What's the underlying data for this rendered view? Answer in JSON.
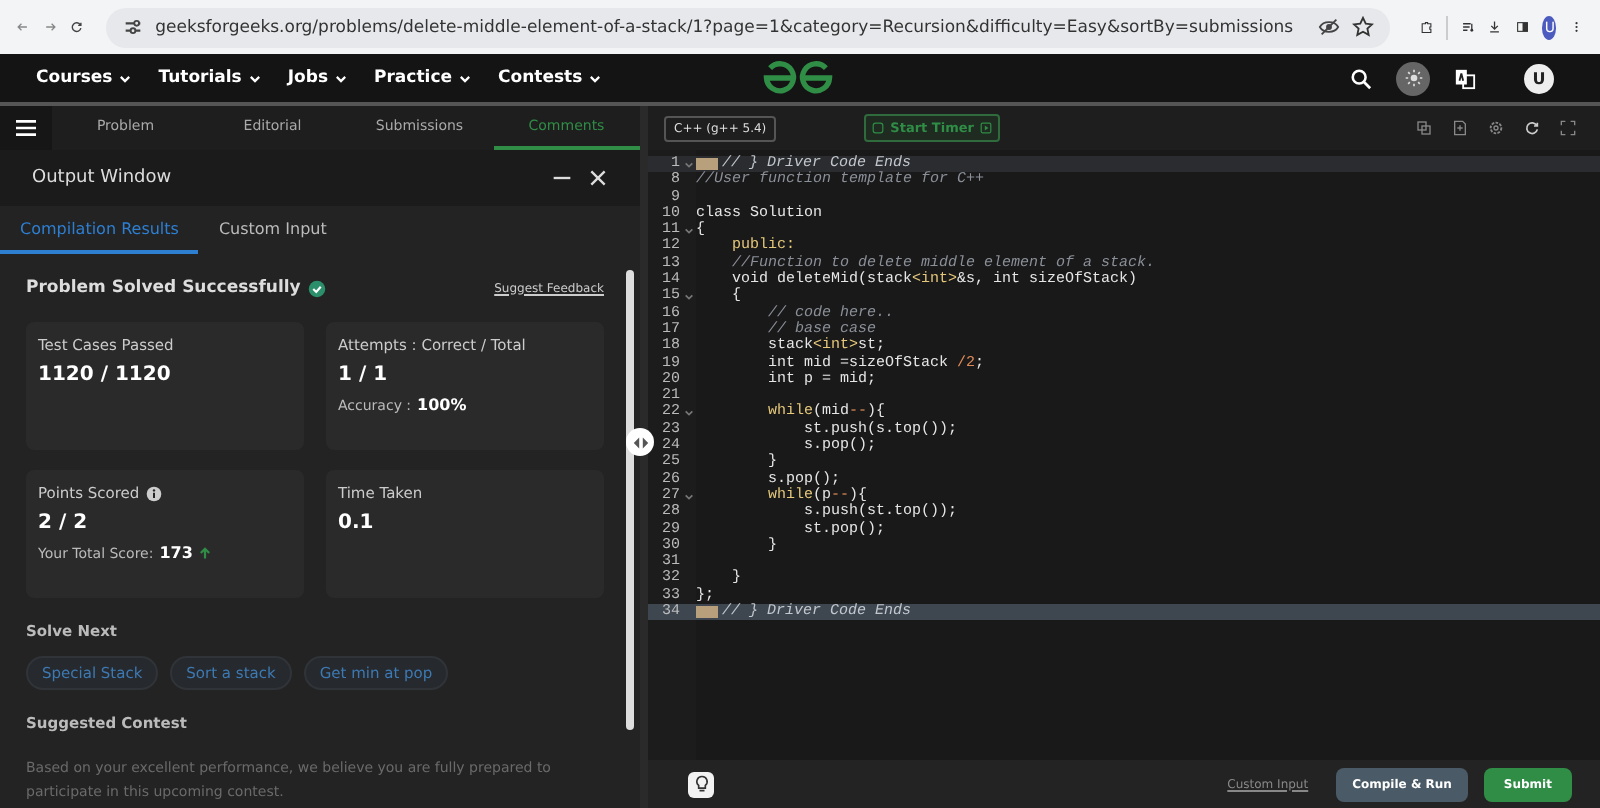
{
  "browser": {
    "url": "geeksforgeeks.org/problems/delete-middle-element-of-a-stack/1?page=1&category=Recursion&difficulty=Easy&sortBy=submissions",
    "avatar": "U"
  },
  "nav": {
    "items": [
      "Courses",
      "Tutorials",
      "Jobs",
      "Practice",
      "Contests"
    ],
    "avatar": "U"
  },
  "problem_tabs": [
    {
      "label": "Problem",
      "selected": false
    },
    {
      "label": "Editorial",
      "selected": false
    },
    {
      "label": "Submissions",
      "selected": false
    },
    {
      "label": "Comments",
      "selected": true
    }
  ],
  "output_window": {
    "title": "Output Window",
    "tabs": [
      {
        "label": "Compilation Results",
        "selected": true
      },
      {
        "label": "Custom Input",
        "selected": false
      }
    ],
    "status": "Problem Solved Successfully",
    "feedback_link": "Suggest Feedback",
    "cards": [
      {
        "label": "Test Cases Passed",
        "value": "1120 / 1120"
      },
      {
        "label": "Attempts : Correct / Total",
        "value": "1 / 1",
        "note": "Accuracy :",
        "note_value": "100%"
      },
      {
        "label": "Points Scored",
        "value": "2 / 2",
        "note": "Your Total Score:",
        "note_value": "173",
        "info": true,
        "trend_up": true
      },
      {
        "label": "Time Taken",
        "value": "0.1"
      }
    ],
    "solve_next": {
      "title": "Solve Next",
      "items": [
        "Special Stack",
        "Sort a stack",
        "Get min at pop"
      ]
    },
    "suggested_contest": {
      "title": "Suggested Contest",
      "text": "Based on your excellent performance, we believe you are fully prepared to participate in this upcoming contest."
    }
  },
  "editor": {
    "language": "C++ (g++ 5.4)",
    "timer": "Start Timer",
    "lines": [
      {
        "num": "1",
        "foldable": true,
        "collapsed": true,
        "highlighted": true,
        "segments": [
          {
            "t": "// } Driver Code Ends",
            "kind": "comment"
          }
        ]
      },
      {
        "num": "8",
        "segments": [
          {
            "t": "//User function template for C++",
            "kind": "comment"
          }
        ]
      },
      {
        "num": "9"
      },
      {
        "num": "10",
        "segments": [
          {
            "t": "class Solution",
            "kind": "code"
          }
        ]
      },
      {
        "num": "11",
        "foldable": true,
        "segments": [
          {
            "t": "{",
            "kind": "code"
          }
        ]
      },
      {
        "num": "12",
        "segments": [
          {
            "t": "    public:",
            "kind": "keyword"
          }
        ]
      },
      {
        "num": "13",
        "segments": [
          {
            "t": "    //Function to delete middle element of a stack.",
            "kind": "comment"
          }
        ]
      },
      {
        "num": "14",
        "segments": [
          {
            "t": "    void deleteMid(stack",
            "kind": "code"
          },
          {
            "t": "<int>",
            "kind": "keyword"
          },
          {
            "t": "&s, int sizeOfStack)",
            "kind": "code"
          }
        ]
      },
      {
        "num": "15",
        "foldable": true,
        "segments": [
          {
            "t": "    {",
            "kind": "code"
          }
        ]
      },
      {
        "num": "16",
        "segments": [
          {
            "t": "        // code here..",
            "kind": "comment"
          }
        ]
      },
      {
        "num": "17",
        "segments": [
          {
            "t": "        // base case",
            "kind": "comment"
          }
        ]
      },
      {
        "num": "18",
        "segments": [
          {
            "t": "        stack",
            "kind": "code"
          },
          {
            "t": "<int>",
            "kind": "keyword"
          },
          {
            "t": "st;",
            "kind": "code"
          }
        ]
      },
      {
        "num": "19",
        "segments": [
          {
            "t": "        int mid =sizeOfStack ",
            "kind": "code"
          },
          {
            "t": "/2",
            "kind": "operator"
          },
          {
            "t": ";",
            "kind": "code"
          }
        ]
      },
      {
        "num": "20",
        "segments": [
          {
            "t": "        int p = mid;",
            "kind": "code"
          }
        ]
      },
      {
        "num": "21"
      },
      {
        "num": "22",
        "foldable": true,
        "segments": [
          {
            "t": "        while",
            "kind": "keyword"
          },
          {
            "t": "(mid",
            "kind": "code"
          },
          {
            "t": "--",
            "kind": "operator"
          },
          {
            "t": "){",
            "kind": "code"
          }
        ]
      },
      {
        "num": "23",
        "segments": [
          {
            "t": "            st.push(s.top());",
            "kind": "code"
          }
        ]
      },
      {
        "num": "24",
        "segments": [
          {
            "t": "            s.pop();",
            "kind": "code"
          }
        ]
      },
      {
        "num": "25",
        "segments": [
          {
            "t": "        }",
            "kind": "code"
          }
        ]
      },
      {
        "num": "26",
        "segments": [
          {
            "t": "        s.pop();",
            "kind": "code"
          }
        ]
      },
      {
        "num": "27",
        "foldable": true,
        "segments": [
          {
            "t": "        while",
            "kind": "keyword"
          },
          {
            "t": "(p",
            "kind": "code"
          },
          {
            "t": "--",
            "kind": "operator"
          },
          {
            "t": "){",
            "kind": "code"
          }
        ]
      },
      {
        "num": "28",
        "segments": [
          {
            "t": "            s.push(st.top());",
            "kind": "code"
          }
        ]
      },
      {
        "num": "29",
        "segments": [
          {
            "t": "            st.pop();",
            "kind": "code"
          }
        ]
      },
      {
        "num": "30",
        "segments": [
          {
            "t": "        }",
            "kind": "code"
          }
        ]
      },
      {
        "num": "31"
      },
      {
        "num": "32",
        "segments": [
          {
            "t": "    }",
            "kind": "code"
          }
        ]
      },
      {
        "num": "33",
        "segments": [
          {
            "t": "};",
            "kind": "code"
          }
        ]
      },
      {
        "num": "34",
        "collapsed": true,
        "highlighted": true,
        "segments": [
          {
            "t": "// } Driver Code Ends",
            "kind": "comment"
          }
        ]
      }
    ],
    "footer": {
      "custom_input": "Custom Input",
      "compile": "Compile & Run",
      "submit": "Submit"
    }
  }
}
